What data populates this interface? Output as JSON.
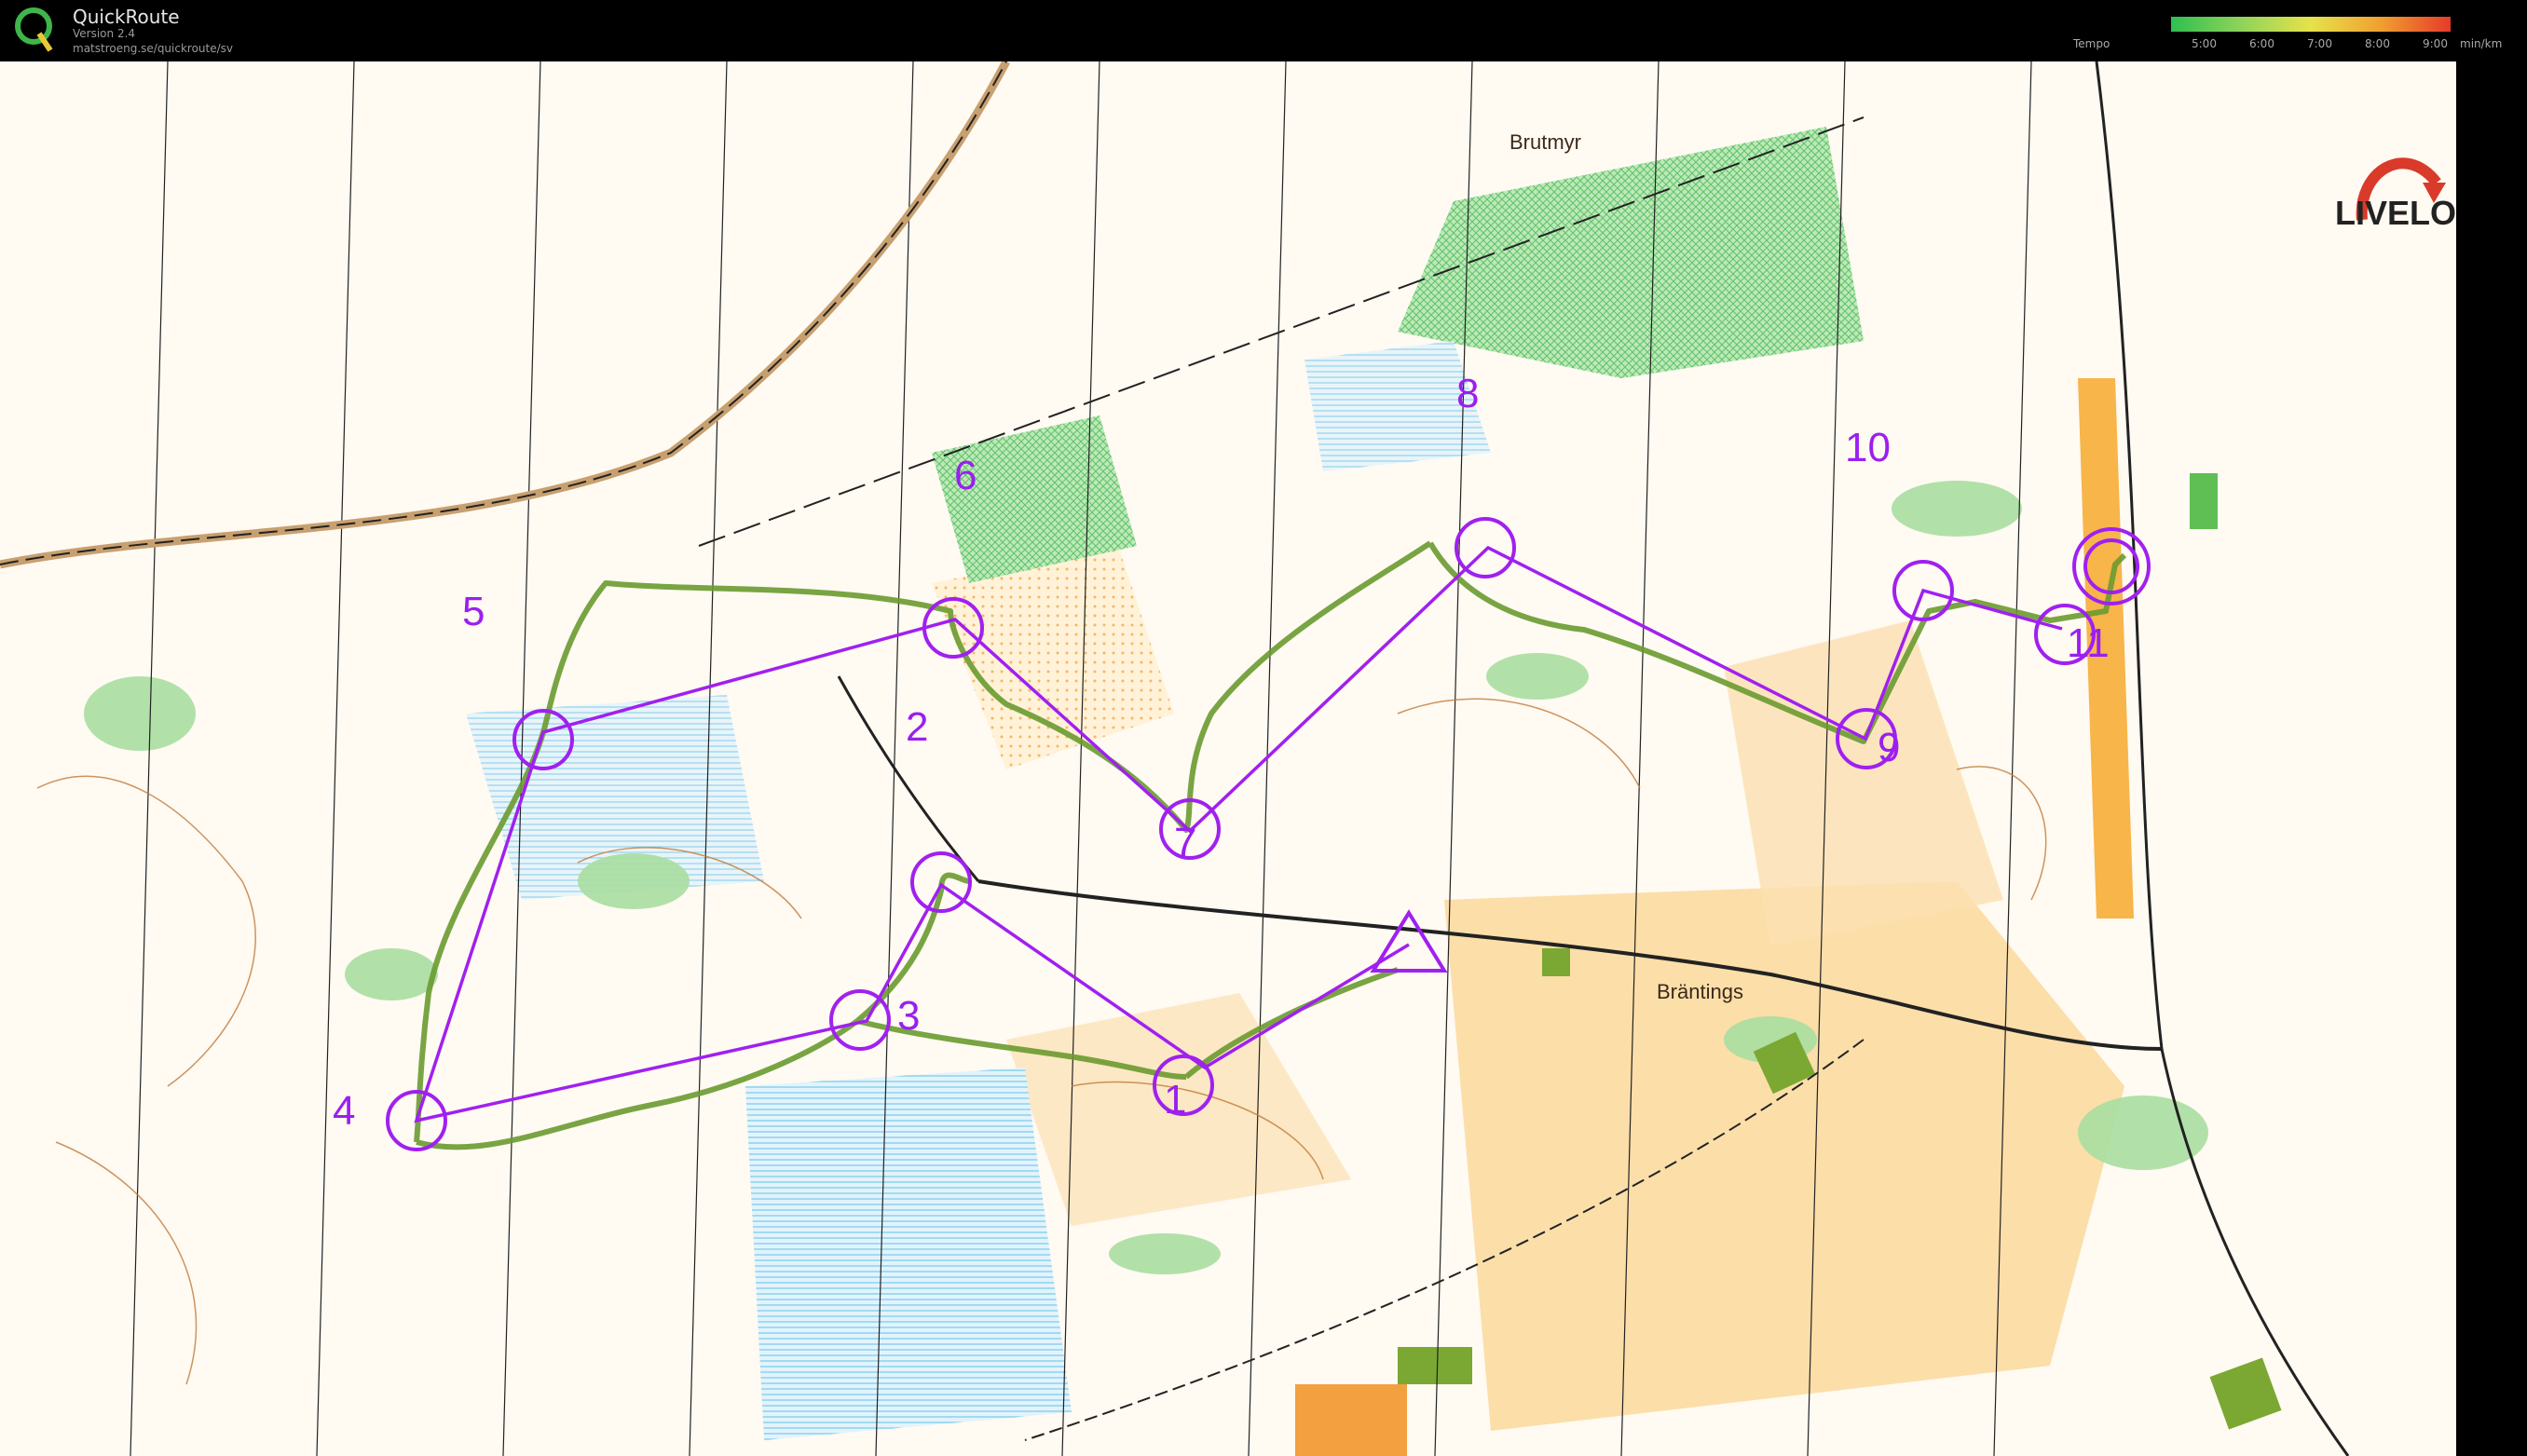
{
  "app": {
    "name": "QuickRoute",
    "version": "Version 2.4",
    "url": "matstroeng.se/quickroute/sv"
  },
  "tempo": {
    "label": "Tempo",
    "unit": "min/km",
    "ticks": [
      "5:00",
      "6:00",
      "7:00",
      "8:00",
      "9:00"
    ],
    "colors": [
      "#2fbf4f",
      "#8fd35a",
      "#e6e24a",
      "#f0a030",
      "#e63a2a"
    ]
  },
  "brand": {
    "logo_text": "LIVELOX"
  },
  "map": {
    "place_names": [
      "Brutmyr",
      "Bräntings"
    ],
    "controls": [
      "1",
      "2",
      "3",
      "4",
      "5",
      "6",
      "7",
      "8",
      "9",
      "10",
      "11"
    ],
    "course_color": "#a020f0",
    "route_color": "#5a8a2a"
  }
}
